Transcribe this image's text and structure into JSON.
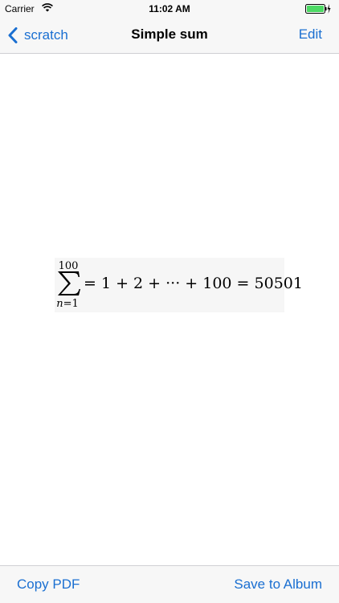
{
  "status_bar": {
    "carrier": "Carrier",
    "time": "11:02 AM",
    "icons": [
      "wifi-icon",
      "battery-icon",
      "charging-bolt-icon"
    ],
    "battery_color": "#4cd964"
  },
  "nav_bar": {
    "back_label": "scratch",
    "title": "Simple sum",
    "edit_label": "Edit",
    "accent_color": "#1a6fd1"
  },
  "formula": {
    "upper_limit": "100",
    "index": "n",
    "lower_eq": "=1",
    "rhs": "= 1 + 2 + ··· + 100 = 50501"
  },
  "toolbar": {
    "copy_pdf_label": "Copy PDF",
    "save_album_label": "Save to Album"
  }
}
